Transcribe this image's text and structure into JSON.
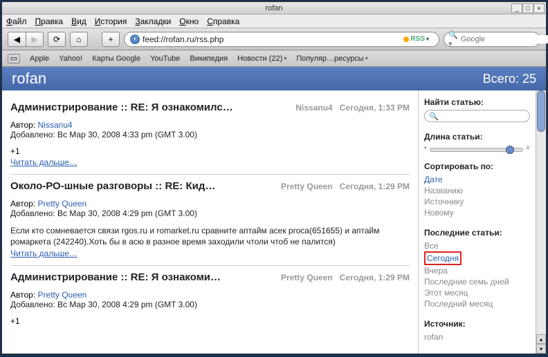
{
  "window": {
    "title": "rofan"
  },
  "menubar": [
    "Файл",
    "Правка",
    "Вид",
    "История",
    "Закладки",
    "Окно",
    "Справка"
  ],
  "url": "feed://rofan.ru/rss.php",
  "rss_label": "RSS",
  "search_placeholder": "Google",
  "bookmarks": [
    {
      "label": "Apple"
    },
    {
      "label": "Yahoo!"
    },
    {
      "label": "Карты Google"
    },
    {
      "label": "YouTube"
    },
    {
      "label": "Википедия"
    },
    {
      "label": "Новости (22)",
      "dropdown": true
    },
    {
      "label": "Популяр…ресурсы",
      "dropdown": true
    }
  ],
  "feed": {
    "title": "rofan",
    "count_label": "Всего: 25"
  },
  "articles": [
    {
      "title": "Администрирование :: RE: Я ознакомилс…",
      "author": "Nissanu4",
      "date": "Сегодня, 1:33 PM",
      "author_label": "Автор:",
      "author_link": "Nissanu4",
      "added": "Добавлено: Вс Мар 30, 2008 4:33 pm (GMT 3.00)",
      "body_extra": "+1",
      "read_more": "Читать дальше…"
    },
    {
      "title": "Около-РО-шные разговоры :: RE: Кид…",
      "author": "Pretty Queen",
      "date": "Сегодня, 1:29 PM",
      "author_label": "Автор:",
      "author_link": "Pretty Queen",
      "added": "Добавлено: Вс Мар 30, 2008 4:29 pm (GMT 3.00)",
      "body": "Если кто сомневается связи rgos.ru и romarket.ru сравните аптайм асек proca(651655) и аптайм ромаркета (242240).Хоть бы в асю в разное время заходили чтоли чтоб не палится)",
      "read_more": "Читать дальше…"
    },
    {
      "title": "Администрирование :: RE: Я ознакоми…",
      "author": "Pretty Queen",
      "date": "Сегодня, 1:29 PM",
      "author_label": "Автор:",
      "author_link": "Pretty Queen",
      "added": "Добавлено: Вс Мар 30, 2008 4:29 pm (GMT 3.00)",
      "body_extra": "+1",
      "read_more": "Читать дальше…"
    }
  ],
  "sidebar": {
    "search_label": "Найти статью:",
    "length_label": "Длина статьи:",
    "sort_label": "Сортировать по:",
    "sort_items": [
      "Дате",
      "Названию",
      "Источнику",
      "Новому"
    ],
    "recent_label": "Последние статьи:",
    "recent_items": [
      "Все",
      "Сегодня",
      "Вчера",
      "Последние семь дней",
      "Этот месяц",
      "Последний месяц"
    ],
    "source_label": "Источник:",
    "source_items": [
      "rofan"
    ]
  }
}
